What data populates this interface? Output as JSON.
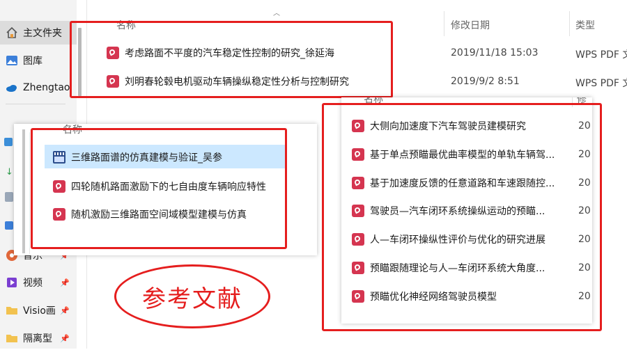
{
  "sidebar": {
    "items": [
      {
        "label": "主文件夹",
        "icon": "home-icon"
      },
      {
        "label": "图库",
        "icon": "gallery-icon"
      },
      {
        "label": "Zhengtao",
        "icon": "onedrive-cloud-icon"
      },
      {
        "label": "音乐",
        "icon": "music-icon"
      },
      {
        "label": "视频",
        "icon": "video-icon"
      },
      {
        "label": "Visio画",
        "icon": "folder-icon"
      },
      {
        "label": "隔离型",
        "icon": "folder-icon"
      }
    ]
  },
  "main": {
    "columns": {
      "name": "名称",
      "modified": "修改日期",
      "type": "类型"
    },
    "files": [
      {
        "name": "考虑路面不平度的汽车稳定性控制的研究_徐延海",
        "date": "2019/11/18 15:03",
        "type": "WPS PDF 文"
      },
      {
        "name": "刘明春轮毂电机驱动车辆操纵稳定性分析与控制研究",
        "date": "2019/9/2 8:51",
        "type": "WPS PDF 文"
      }
    ]
  },
  "left_panel": {
    "header": "名称",
    "files": [
      {
        "name": "三维路面谱的仿真建模与验证_吴参",
        "icon": "video-file-icon"
      },
      {
        "name": "四轮随机路面激励下的七自由度车辆响应特性",
        "icon": "pdf-icon"
      },
      {
        "name": "随机激励三维路面空间域模型建模与仿真",
        "icon": "pdf-icon"
      }
    ]
  },
  "right_panel": {
    "header": "名称",
    "header2": "修",
    "files": [
      {
        "name": "大侧向加速度下汽车驾驶员建模研究",
        "date": "20"
      },
      {
        "name": "基于单点预瞄最优曲率模型的单轨车辆驾...",
        "date": "20"
      },
      {
        "name": "基于加速度反馈的任意道路和车速跟随控...",
        "date": "20"
      },
      {
        "name": "驾驶员—汽车闭环系统操纵运动的预瞄...",
        "date": "20"
      },
      {
        "name": "人—车闭环操纵性评价与优化的研究进展",
        "date": "20"
      },
      {
        "name": "预瞄跟随理论与人—车闭环系统大角度...",
        "date": "20"
      },
      {
        "name": "预瞄优化神经网络驾驶员模型",
        "date": "20"
      }
    ]
  },
  "annotation": {
    "text": "参考文献"
  },
  "colors": {
    "accent": "#e51e1e",
    "pdf": "#d53550",
    "selected": "#cce8ff"
  }
}
